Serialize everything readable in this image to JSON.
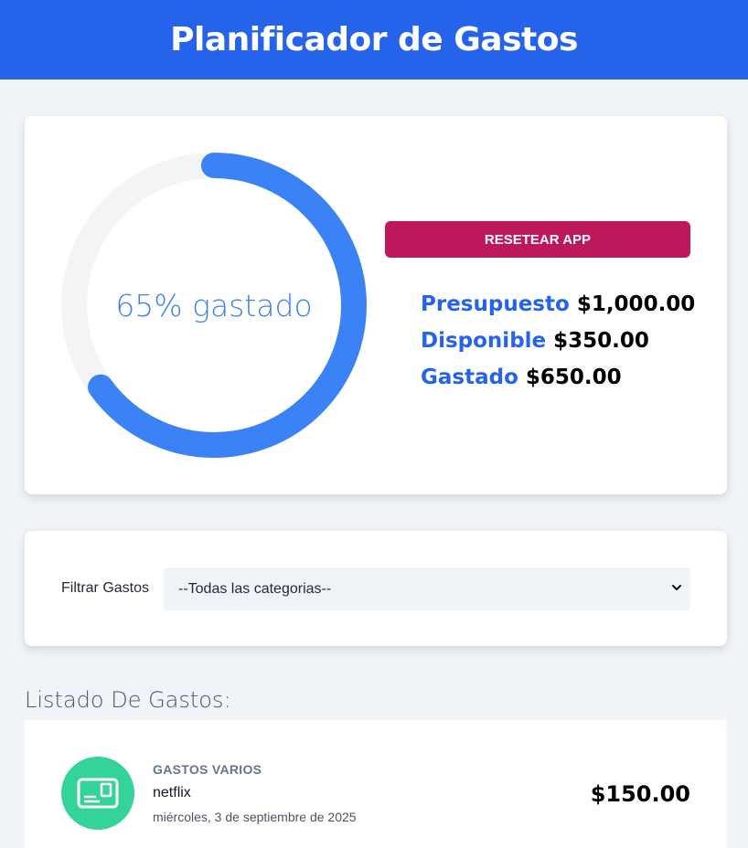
{
  "header": {
    "title": "Planificador de Gastos"
  },
  "budget": {
    "percent_label": "65% gastado",
    "percent_spent": 0.65,
    "reset_label": "Resetear App",
    "stats": [
      {
        "key": "Presupuesto",
        "value": "$1,000.00"
      },
      {
        "key": "Disponible",
        "value": "$350.00"
      },
      {
        "key": "Gastado",
        "value": "$650.00"
      }
    ]
  },
  "filter": {
    "label": "Filtrar Gastos",
    "selected": "--Todas las categorias--"
  },
  "list": {
    "title": "Listado De Gastos:",
    "items": [
      {
        "category": "Gastos varios",
        "name": "netflix",
        "date": "miércoles, 3 de septiembre de 2025",
        "amount": "$150.00",
        "icon": "subscription-icon"
      }
    ]
  },
  "colors": {
    "brand": "#2563eb",
    "progress": "#3b82f6",
    "track": "#f3f4f6",
    "reset": "#be185d",
    "category_icon_bg": "#34d399"
  }
}
